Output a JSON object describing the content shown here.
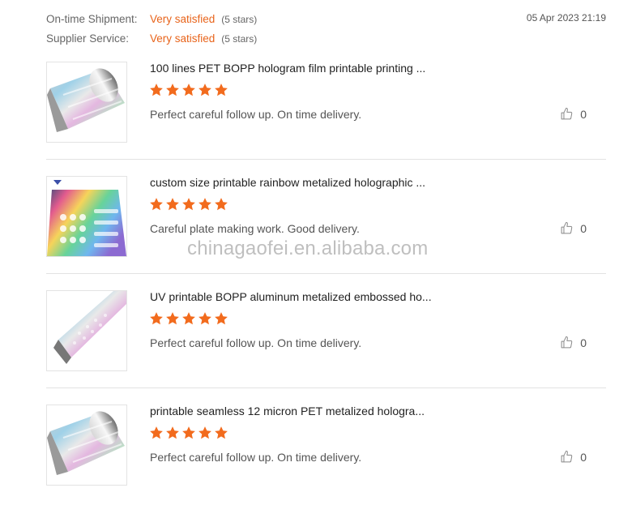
{
  "ratings": [
    {
      "label": "On-time Shipment:",
      "value": "Very satisfied",
      "note": "(5 stars)"
    },
    {
      "label": "Supplier Service:",
      "value": "Very satisfied",
      "note": "(5 stars)"
    }
  ],
  "date": "05 Apr 2023 21:19",
  "accent_color": "#e8641b",
  "reviews": [
    {
      "title": "100 lines PET BOPP hologram film printable printing ...",
      "stars": 5,
      "comment": "Perfect careful follow up.  On time delivery.",
      "likes": "0",
      "image": "holographic-film-roll"
    },
    {
      "title": "custom size printable rainbow metalized holographic ...",
      "stars": 5,
      "comment": "Careful plate making work.  Good delivery.",
      "likes": "0",
      "image": "holographic-plate"
    },
    {
      "title": "UV printable BOPP aluminum metalized embossed ho...",
      "stars": 5,
      "comment": "Perfect careful follow up.  On time delivery.",
      "likes": "0",
      "image": "holographic-roll-closeup"
    },
    {
      "title": "printable seamless 12 micron PET metalized hologra...",
      "stars": 5,
      "comment": "Perfect careful follow up.  On time delivery.",
      "likes": "0",
      "image": "holographic-film-roll"
    }
  ],
  "watermark": "chinagaofei.en.alibaba.com"
}
